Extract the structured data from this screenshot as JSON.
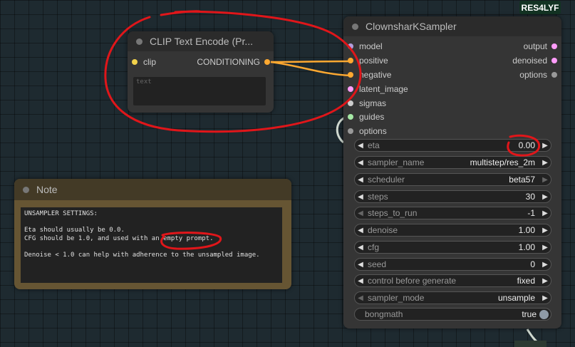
{
  "badge": "RES4LYF",
  "clip_node": {
    "title": "CLIP Text Encode (Pr...",
    "input_label": "clip",
    "output_label": "CONDITIONING",
    "text_placeholder": "text"
  },
  "note_node": {
    "title": "Note",
    "text": "UNSAMPLER SETTINGS:\n\nEta should usually be 0.0.\nCFG should be 1.0, and used with an empty prompt.\n\nDenoise < 1.0 can help with adherence to the unsampled image."
  },
  "sampler_node": {
    "title": "ClownsharKSampler",
    "inputs": [
      "model",
      "positive",
      "negative",
      "latent_image",
      "sigmas",
      "guides",
      "options"
    ],
    "outputs": [
      "output",
      "denoised",
      "options"
    ],
    "widgets": [
      {
        "label": "eta",
        "value": "0.00"
      },
      {
        "label": "sampler_name",
        "value": "multistep/res_2m"
      },
      {
        "label": "scheduler",
        "value": "beta57"
      },
      {
        "label": "steps",
        "value": "30"
      },
      {
        "label": "steps_to_run",
        "value": "-1"
      },
      {
        "label": "denoise",
        "value": "1.00"
      },
      {
        "label": "cfg",
        "value": "1.00"
      },
      {
        "label": "seed",
        "value": "0"
      },
      {
        "label": "control before generate",
        "value": "fixed"
      },
      {
        "label": "sampler_mode",
        "value": "unsample"
      },
      {
        "label": "bongmath",
        "value": "true"
      }
    ]
  },
  "colors": {
    "clip_slot": "#f2d24b",
    "conditioning_slot": "#ffa931",
    "model_slot": "#b39ddb",
    "latent_slot": "#ff9cf9",
    "sigmas_slot": "#cccccc",
    "guides_slot": "#a5e8a5",
    "options_slot": "#999999",
    "annotation_red": "#e0161a"
  }
}
